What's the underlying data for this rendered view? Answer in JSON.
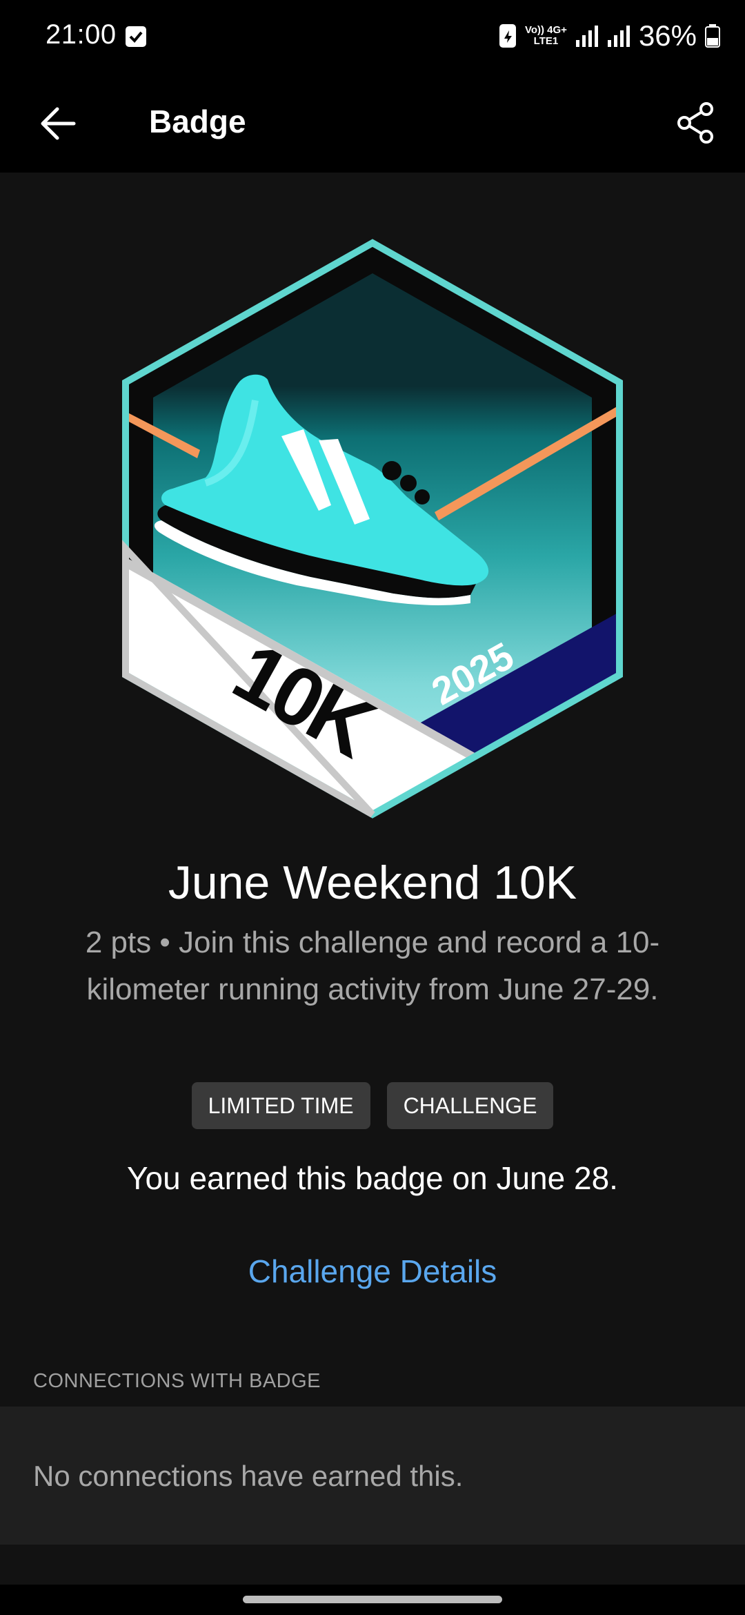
{
  "status_bar": {
    "time": "21:00",
    "network_top": "Vo)) 4G+",
    "network_bottom": "LTE1",
    "battery_percent": "36%"
  },
  "app_bar": {
    "title": "Badge",
    "back_icon": "arrow-left-icon",
    "share_icon": "share-icon"
  },
  "badge": {
    "main_text": "10K",
    "year_text": "2025",
    "colors": {
      "frame": "#5fd6cf",
      "shoe": "#3fe3e3",
      "stripe": "#f4975a",
      "year_band": "#12146b"
    }
  },
  "details": {
    "title": "June Weekend 10K",
    "description": "2 pts • Join this challenge and record a 10-kilometer running activity from June 27-29.",
    "tags": [
      "LIMITED TIME",
      "CHALLENGE"
    ],
    "earned_text": "You earned this badge on June 28.",
    "link_text": "Challenge Details",
    "link_color": "#5aa7ee"
  },
  "connections": {
    "header": "CONNECTIONS WITH BADGE",
    "empty_text": "No connections have earned this."
  }
}
